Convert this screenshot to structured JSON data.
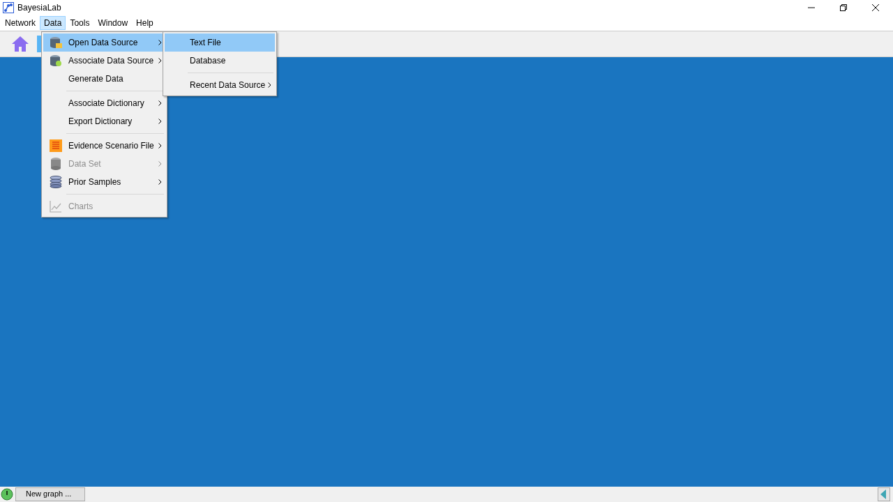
{
  "window": {
    "title": "BayesiaLab"
  },
  "menubar": [
    {
      "label": "Network",
      "selected": false
    },
    {
      "label": "Data",
      "selected": true
    },
    {
      "label": "Tools",
      "selected": false
    },
    {
      "label": "Window",
      "selected": false
    },
    {
      "label": "Help",
      "selected": false
    }
  ],
  "data_menu": [
    {
      "kind": "item",
      "label": "Open Data Source",
      "submenu": true,
      "disabled": false,
      "selected": true
    },
    {
      "kind": "item",
      "label": "Associate Data Source",
      "submenu": true,
      "disabled": false,
      "selected": false
    },
    {
      "kind": "item",
      "label": "Generate Data",
      "submenu": false,
      "disabled": false,
      "selected": false
    },
    {
      "kind": "separator"
    },
    {
      "kind": "item",
      "label": "Associate Dictionary",
      "submenu": true,
      "disabled": false,
      "selected": false
    },
    {
      "kind": "item",
      "label": "Export Dictionary",
      "submenu": true,
      "disabled": false,
      "selected": false
    },
    {
      "kind": "separator"
    },
    {
      "kind": "item",
      "label": "Evidence Scenario File",
      "submenu": true,
      "disabled": false,
      "selected": false
    },
    {
      "kind": "item",
      "label": "Data Set",
      "submenu": true,
      "disabled": true,
      "selected": false
    },
    {
      "kind": "item",
      "label": "Prior Samples",
      "submenu": true,
      "disabled": false,
      "selected": false
    },
    {
      "kind": "separator"
    },
    {
      "kind": "item",
      "label": "Charts",
      "submenu": false,
      "disabled": true,
      "selected": false
    }
  ],
  "open_data_source_menu": [
    {
      "kind": "item",
      "label": "Text File",
      "submenu": false,
      "disabled": false,
      "selected": true
    },
    {
      "kind": "item",
      "label": "Database",
      "submenu": false,
      "disabled": false,
      "selected": false
    },
    {
      "kind": "separator"
    },
    {
      "kind": "item",
      "label": "Recent Data Source",
      "submenu": true,
      "disabled": false,
      "selected": false
    }
  ],
  "status_bar": {
    "task": "New graph ..."
  }
}
